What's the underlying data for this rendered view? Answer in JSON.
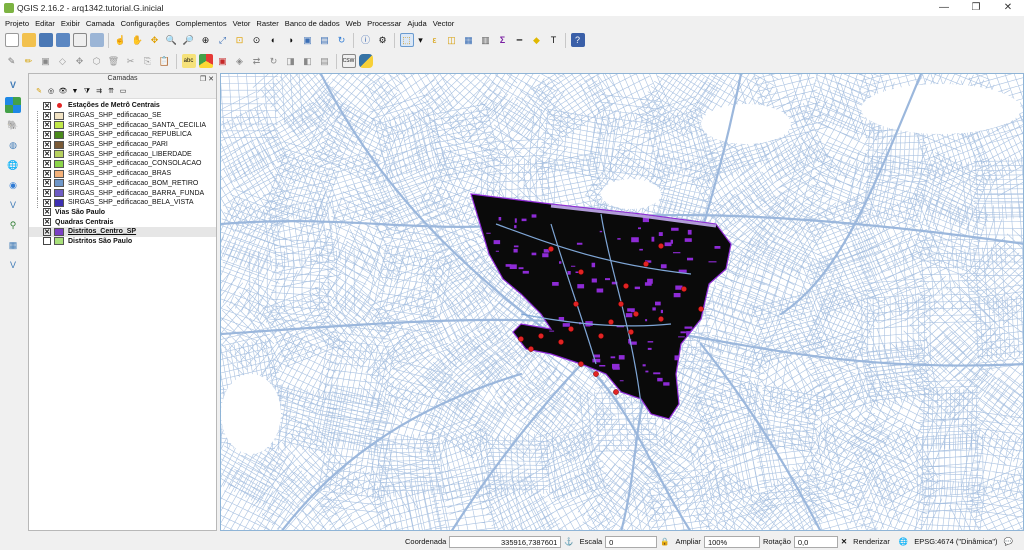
{
  "window": {
    "title": "QGIS 2.16.2 - arq1342.tutorial.G.inicial",
    "minimize": "—",
    "maximize": "❐",
    "close": "✕"
  },
  "menu": [
    "Projeto",
    "Editar",
    "Exibir",
    "Camada",
    "Configurações",
    "Complementos",
    "Vetor",
    "Raster",
    "Banco de dados",
    "Web",
    "Processar",
    "Ajuda",
    "Vector"
  ],
  "layers_panel": {
    "title": "Camadas",
    "layers": [
      {
        "name": "Estações de Metrô Centrais",
        "symbol": "point",
        "color": "#e12424",
        "checked": true,
        "bold": true
      },
      {
        "name": "SIRGAS_SHP_edificacao_SE",
        "symbol": "fill",
        "color": "#f2e3c3",
        "checked": true
      },
      {
        "name": "SIRGAS_SHP_edificacao_SANTA_CECILIA",
        "symbol": "fill",
        "color": "#c1e84a",
        "checked": true
      },
      {
        "name": "SIRGAS_SHP_edificacao_REPUBLICA",
        "symbol": "fill",
        "color": "#4a8a1c",
        "checked": true
      },
      {
        "name": "SIRGAS_SHP_edificacao_PARI",
        "symbol": "fill",
        "color": "#7a5a36",
        "checked": true
      },
      {
        "name": "SIRGAS_SHP_edificacao_LIBERDADE",
        "symbol": "fill",
        "color": "#b6d05f",
        "checked": true
      },
      {
        "name": "SIRGAS_SHP_edificacao_CONSOLACAO",
        "symbol": "fill",
        "color": "#8bd44a",
        "checked": true
      },
      {
        "name": "SIRGAS_SHP_edificacao_BRAS",
        "symbol": "fill",
        "color": "#f5b27a",
        "checked": true
      },
      {
        "name": "SIRGAS_SHP_edificacao_BOM_RETIRO",
        "symbol": "fill",
        "color": "#6f97c9",
        "checked": true
      },
      {
        "name": "SIRGAS_SHP_edificacao_BARRA_FUNDA",
        "symbol": "fill",
        "color": "#6e5cc4",
        "checked": true
      },
      {
        "name": "SIRGAS_SHP_edificacao_BELA_VISTA",
        "symbol": "fill",
        "color": "#3d2fb2",
        "checked": true
      },
      {
        "name": "Vias São Paulo",
        "symbol": "none",
        "color": "",
        "checked": true,
        "bold": true
      },
      {
        "name": "Quadras Centrais",
        "symbol": "none",
        "color": "",
        "checked": true,
        "bold": true
      },
      {
        "name": "Distritos_Centro_SP",
        "symbol": "fill",
        "color": "#7b3fc4",
        "checked": true,
        "bold": true,
        "underline": true,
        "selected": true
      },
      {
        "name": "Distritos São Paulo",
        "symbol": "fill",
        "color": "#a8e07a",
        "checked": false,
        "bold": true
      }
    ]
  },
  "status": {
    "coord_label": "Coordenada",
    "coord_value": "335916,7387601",
    "scale_label": "Escala",
    "scale_value": "0",
    "magnify_label": "Ampliar",
    "magnify_value": "100%",
    "rotation_label": "Rotação",
    "rotation_value": "0,0",
    "render_label": "Renderizar",
    "crs": "EPSG:4674 (\"Dinâmica\")"
  },
  "colors": {
    "roads": "#9bb7dc",
    "district_fill": "#0a0a0a",
    "district_accent": "#8e2bd6",
    "station": "#e12424"
  }
}
